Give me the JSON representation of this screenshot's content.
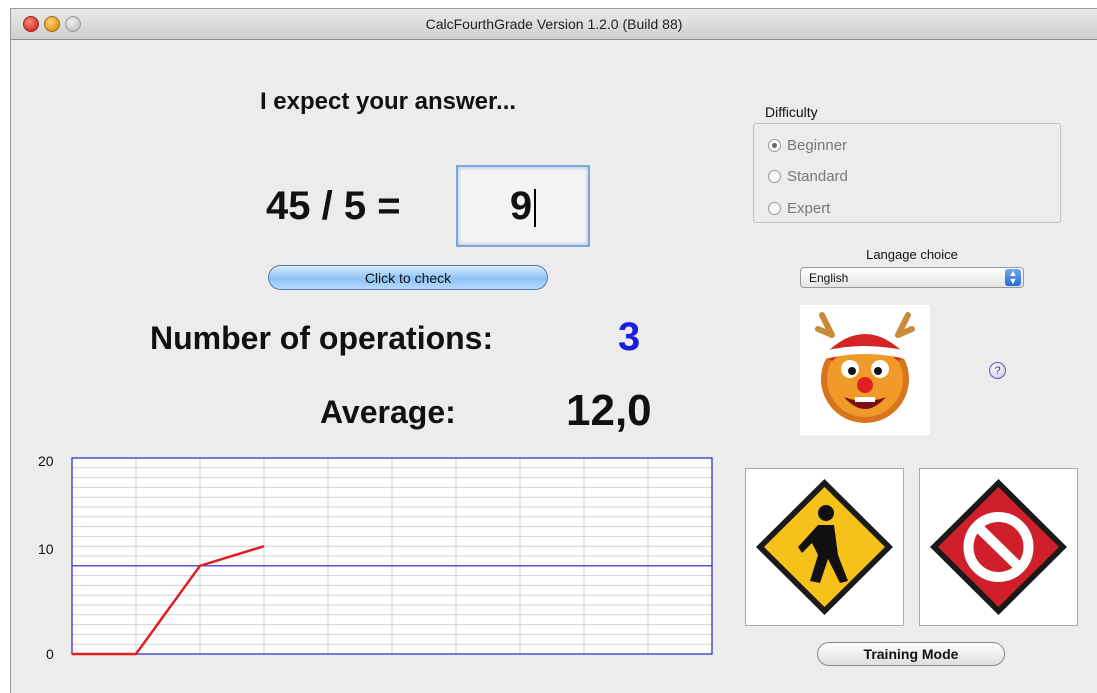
{
  "window": {
    "title": "CalcFourthGrade  Version 1.2.0 (Build 88)"
  },
  "prompt": "I expect your answer...",
  "question": "45 / 5 =",
  "answer_value": "9",
  "check_button": "Click to check",
  "operations": {
    "label": "Number of operations:",
    "value": "3"
  },
  "average": {
    "label": "Average:",
    "value": "12,0"
  },
  "difficulty": {
    "legend": "Difficulty",
    "options": [
      "Beginner",
      "Standard",
      "Expert"
    ],
    "selected": "Beginner"
  },
  "language": {
    "label": "Langage choice",
    "selected": "English"
  },
  "help_label": "?",
  "training_button": "Training Mode",
  "icons": {
    "go": "pedestrian-sign-icon",
    "stop": "stop-sign-icon",
    "mascot": "reindeer-mascot-icon"
  },
  "colors": {
    "ops_value": "#1a1ee0",
    "chart_line": "#e01e1e",
    "chart_border": "#2323c8"
  },
  "chart_data": {
    "type": "line",
    "y_ticks": [
      "0",
      "10",
      "20"
    ],
    "ylim": [
      0,
      20
    ],
    "x_count": 10,
    "series": [
      {
        "values": [
          0,
          0,
          9,
          11
        ]
      }
    ],
    "reference_line": 9
  }
}
